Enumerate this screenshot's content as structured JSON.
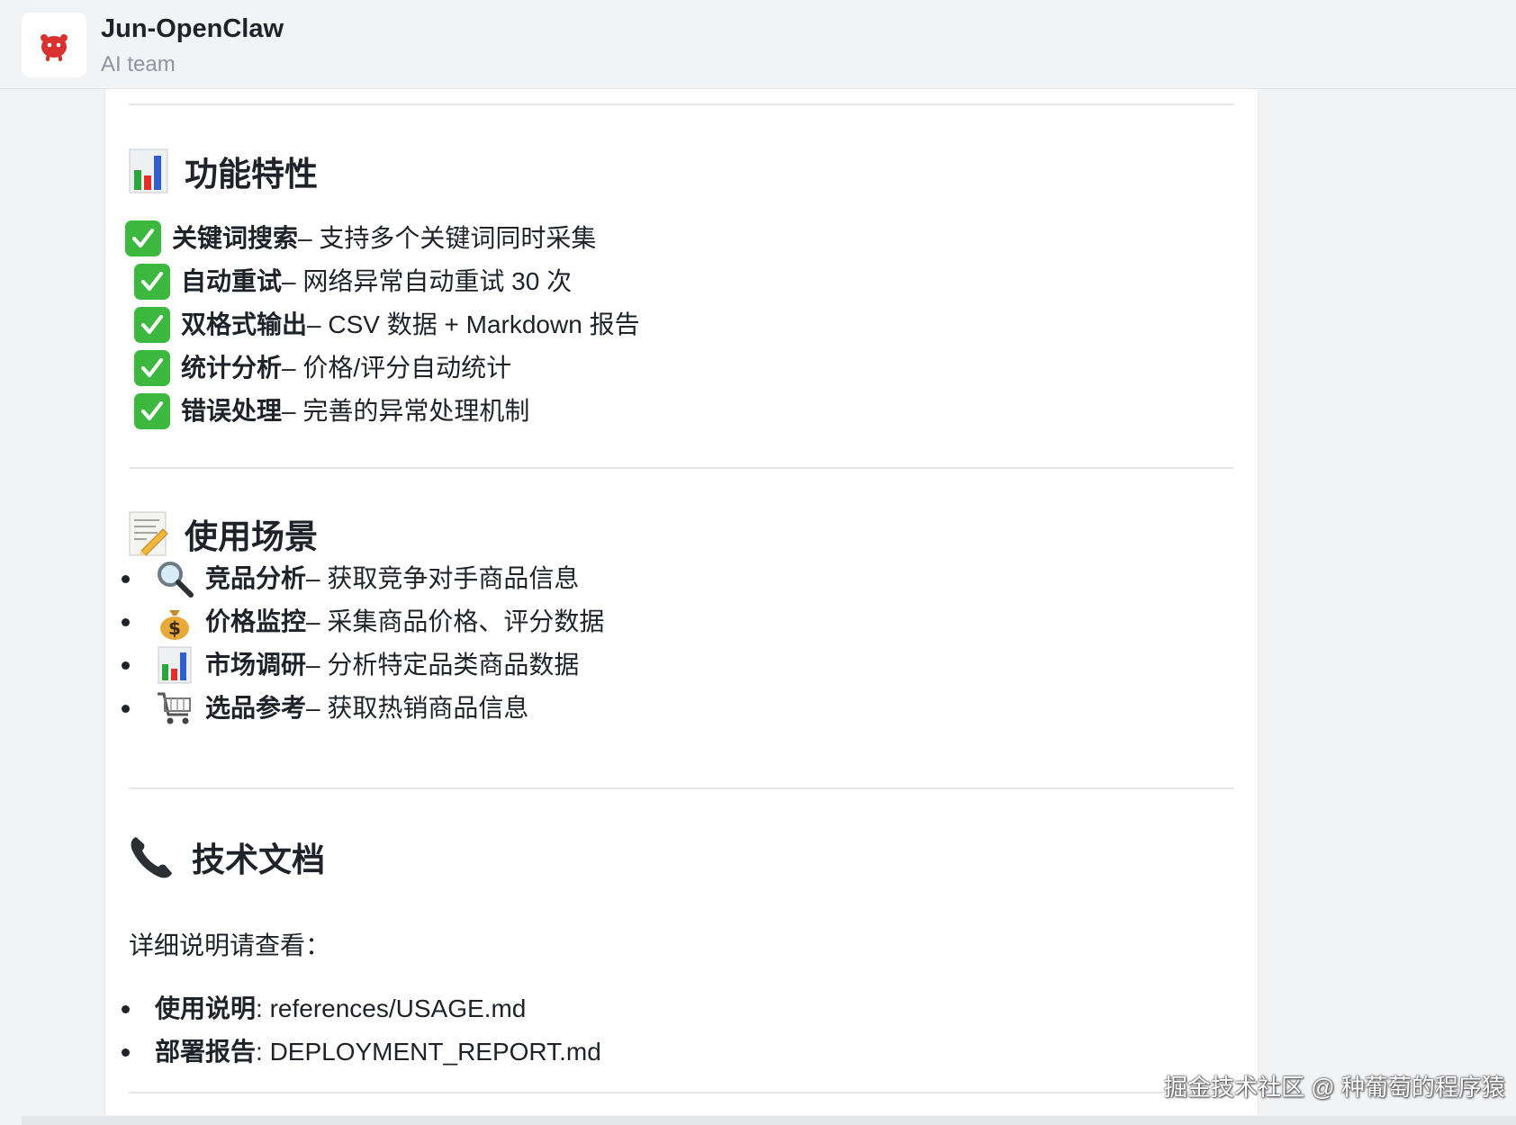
{
  "header": {
    "title": "Jun-OpenClaw",
    "subtitle": "AI team"
  },
  "sections": {
    "features": {
      "title": "功能特性",
      "items": [
        {
          "label": "关键词搜索",
          "desc": " – 支持多个关键词同时采集"
        },
        {
          "label": "自动重试",
          "desc": " – 网络异常自动重试 30 次"
        },
        {
          "label": "双格式输出",
          "desc": " – CSV 数据 + Markdown 报告"
        },
        {
          "label": "统计分析",
          "desc": " – 价格/评分自动统计"
        },
        {
          "label": "错误处理",
          "desc": " – 完善的异常处理机制"
        }
      ]
    },
    "scenarios": {
      "title": "使用场景",
      "items": [
        {
          "icon": "magnifier-icon",
          "label": "竞品分析",
          "desc": " – 获取竞争对手商品信息"
        },
        {
          "icon": "money-bag-icon",
          "label": "价格监控",
          "desc": " – 采集商品价格、评分数据"
        },
        {
          "icon": "bar-chart-icon",
          "label": "市场调研",
          "desc": " – 分析特定品类商品数据"
        },
        {
          "icon": "shopping-cart-icon",
          "label": "选品参考",
          "desc": " – 获取热销商品信息"
        }
      ]
    },
    "docs": {
      "title": "技术文档",
      "intro": "详细说明请查看：",
      "items": [
        {
          "label": "使用说明",
          "value": ": references/USAGE.md"
        },
        {
          "label": "部署报告",
          "value": ": DEPLOYMENT_REPORT.md"
        }
      ]
    }
  },
  "watermark": "掘金技术社区 @ 种葡萄的程序猿",
  "colors": {
    "check": "#3cb83f",
    "accent_red": "#e0302c",
    "background": "#f2f3f5"
  }
}
